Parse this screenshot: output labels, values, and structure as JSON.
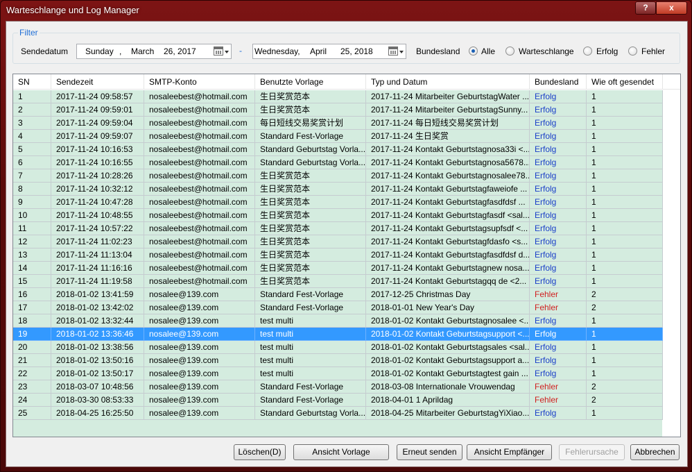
{
  "window": {
    "title": "Warteschlange und Log Manager",
    "help_label": "?",
    "close_label": "x"
  },
  "filter": {
    "group_label": "Filter",
    "send_date_label": "Sendedatum",
    "from": {
      "weekday": "Sunday",
      "sep": ",",
      "month": "March",
      "day_year": "26, 2017"
    },
    "range_sep": "-",
    "to": {
      "weekday": "Wednesday,",
      "month": "April",
      "day_year": "25, 2018"
    },
    "state_label": "Bundesland",
    "options": [
      {
        "label": "Alle",
        "checked": true
      },
      {
        "label": "Warteschlange",
        "checked": false
      },
      {
        "label": "Erfolg",
        "checked": false
      },
      {
        "label": "Fehler",
        "checked": false
      }
    ]
  },
  "table": {
    "columns": [
      "SN",
      "Sendezeit",
      "SMTP-Konto",
      "Benutzte Vorlage",
      "Typ und Datum",
      "Bundesland",
      "Wie oft gesendet"
    ],
    "selected_index": 18,
    "rows": [
      [
        "1",
        "2017-11-24 09:58:57",
        "nosaleebest@hotmail.com",
        "生日奖赏范本",
        "2017-11-24 Mitarbeiter GeburtstagWater ...",
        "Erfolg",
        "1"
      ],
      [
        "2",
        "2017-11-24 09:59:01",
        "nosaleebest@hotmail.com",
        "生日奖赏范本",
        "2017-11-24 Mitarbeiter GeburtstagSunny...",
        "Erfolg",
        "1"
      ],
      [
        "3",
        "2017-11-24 09:59:04",
        "nosaleebest@hotmail.com",
        "每日短线交易奖赏计划",
        "2017-11-24 每日短线交易奖赏计划",
        "Erfolg",
        "1"
      ],
      [
        "4",
        "2017-11-24 09:59:07",
        "nosaleebest@hotmail.com",
        "Standard Fest-Vorlage",
        "2017-11-24 生日奖赏",
        "Erfolg",
        "1"
      ],
      [
        "5",
        "2017-11-24 10:16:53",
        "nosaleebest@hotmail.com",
        "Standard Geburtstag Vorla...",
        "2017-11-24 Kontakt Geburtstagnosa33i <...",
        "Erfolg",
        "1"
      ],
      [
        "6",
        "2017-11-24 10:16:55",
        "nosaleebest@hotmail.com",
        "Standard Geburtstag Vorla...",
        "2017-11-24 Kontakt Geburtstagnosa5678...",
        "Erfolg",
        "1"
      ],
      [
        "7",
        "2017-11-24 10:28:26",
        "nosaleebest@hotmail.com",
        "生日奖赏范本",
        "2017-11-24 Kontakt Geburtstagnosalee78...",
        "Erfolg",
        "1"
      ],
      [
        "8",
        "2017-11-24 10:32:12",
        "nosaleebest@hotmail.com",
        "生日奖赏范本",
        "2017-11-24 Kontakt Geburtstagfaweiofe ...",
        "Erfolg",
        "1"
      ],
      [
        "9",
        "2017-11-24 10:47:28",
        "nosaleebest@hotmail.com",
        "生日奖赏范本",
        "2017-11-24 Kontakt Geburtstagfasdfdsf ...",
        "Erfolg",
        "1"
      ],
      [
        "10",
        "2017-11-24 10:48:55",
        "nosaleebest@hotmail.com",
        "生日奖赏范本",
        "2017-11-24 Kontakt Geburtstagfasdf <sal...",
        "Erfolg",
        "1"
      ],
      [
        "11",
        "2017-11-24 10:57:22",
        "nosaleebest@hotmail.com",
        "生日奖赏范本",
        "2017-11-24 Kontakt Geburtstagsupfsdf <...",
        "Erfolg",
        "1"
      ],
      [
        "12",
        "2017-11-24 11:02:23",
        "nosaleebest@hotmail.com",
        "生日奖赏范本",
        "2017-11-24 Kontakt Geburtstagfdasfo <s...",
        "Erfolg",
        "1"
      ],
      [
        "13",
        "2017-11-24 11:13:04",
        "nosaleebest@hotmail.com",
        "生日奖赏范本",
        "2017-11-24 Kontakt Geburtstagfasdfdsf d...",
        "Erfolg",
        "1"
      ],
      [
        "14",
        "2017-11-24 11:16:16",
        "nosaleebest@hotmail.com",
        "生日奖赏范本",
        "2017-11-24 Kontakt Geburtstagnew nosa...",
        "Erfolg",
        "1"
      ],
      [
        "15",
        "2017-11-24 11:19:58",
        "nosaleebest@hotmail.com",
        "生日奖赏范本",
        "2017-11-24 Kontakt Geburtstagqq de <2...",
        "Erfolg",
        "1"
      ],
      [
        "16",
        "2018-01-02 13:41:59",
        "nosalee@139.com",
        "Standard Fest-Vorlage",
        "2017-12-25 Christmas Day",
        "Fehler",
        "2"
      ],
      [
        "17",
        "2018-01-02 13:42:02",
        "nosalee@139.com",
        "Standard Fest-Vorlage",
        "2018-01-01 New Year's Day",
        "Fehler",
        "2"
      ],
      [
        "18",
        "2018-01-02 13:32:44",
        "nosalee@139.com",
        "test multi",
        "2018-01-02 Kontakt Geburtstagnosalee <...",
        "Erfolg",
        "1"
      ],
      [
        "19",
        "2018-01-02 13:36:46",
        "nosalee@139.com",
        "test multi",
        "2018-01-02 Kontakt Geburtstagsupport <...",
        "Erfolg",
        "1"
      ],
      [
        "20",
        "2018-01-02 13:38:56",
        "nosalee@139.com",
        "test multi",
        "2018-01-02 Kontakt Geburtstagsales <sal...",
        "Erfolg",
        "1"
      ],
      [
        "21",
        "2018-01-02 13:50:16",
        "nosalee@139.com",
        "test multi",
        "2018-01-02 Kontakt Geburtstagsupport a...",
        "Erfolg",
        "1"
      ],
      [
        "22",
        "2018-01-02 13:50:17",
        "nosalee@139.com",
        "test multi",
        "2018-01-02 Kontakt Geburtstagtest gain ...",
        "Erfolg",
        "1"
      ],
      [
        "23",
        "2018-03-07 10:48:56",
        "nosalee@139.com",
        "Standard Fest-Vorlage",
        "2018-03-08 Internationale Vrouwendag",
        "Fehler",
        "2"
      ],
      [
        "24",
        "2018-03-30 08:53:33",
        "nosalee@139.com",
        "Standard Fest-Vorlage",
        "2018-04-01 1 Aprildag",
        "Fehler",
        "2"
      ],
      [
        "25",
        "2018-04-25 16:25:50",
        "nosalee@139.com",
        "Standard Geburtstag Vorla...",
        "2018-04-25 Mitarbeiter GeburtstagYiXiao...",
        "Erfolg",
        "1"
      ]
    ]
  },
  "buttons": {
    "delete": "Löschen(D)",
    "view_template": "Ansicht Vorlage",
    "resend": "Erneut senden",
    "view_recipients": "Ansicht Empfänger",
    "error_cause": "Fehlerursache",
    "cancel": "Abbrechen"
  },
  "colors": {
    "row_bg": "#d4ecdf",
    "selection": "#3399ff",
    "success": "#1a3ec8",
    "error": "#d01f1f",
    "accent": "#1e6ed6"
  }
}
